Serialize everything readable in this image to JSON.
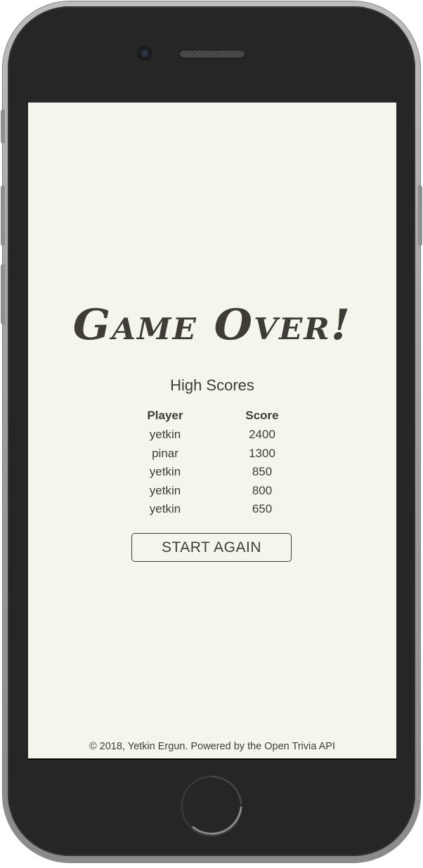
{
  "game": {
    "title": "Game Over!",
    "high_scores_heading": "High Scores",
    "columns": {
      "player": "Player",
      "score": "Score"
    },
    "rows": [
      {
        "player": "yetkin",
        "score": "2400"
      },
      {
        "player": "pinar",
        "score": "1300"
      },
      {
        "player": "yetkin",
        "score": "850"
      },
      {
        "player": "yetkin",
        "score": "800"
      },
      {
        "player": "yetkin",
        "score": "650"
      }
    ],
    "start_again_label": "START AGAIN",
    "footer": "© 2018, Yetkin Ergun. Powered by the Open Trivia API"
  },
  "colors": {
    "screen_background": "#f5f6eb",
    "text": "#3f3c38",
    "device_body": "#262626"
  },
  "icons": {
    "camera": "front-camera-icon",
    "speaker": "earpiece-speaker-icon",
    "home": "home-button-icon"
  }
}
